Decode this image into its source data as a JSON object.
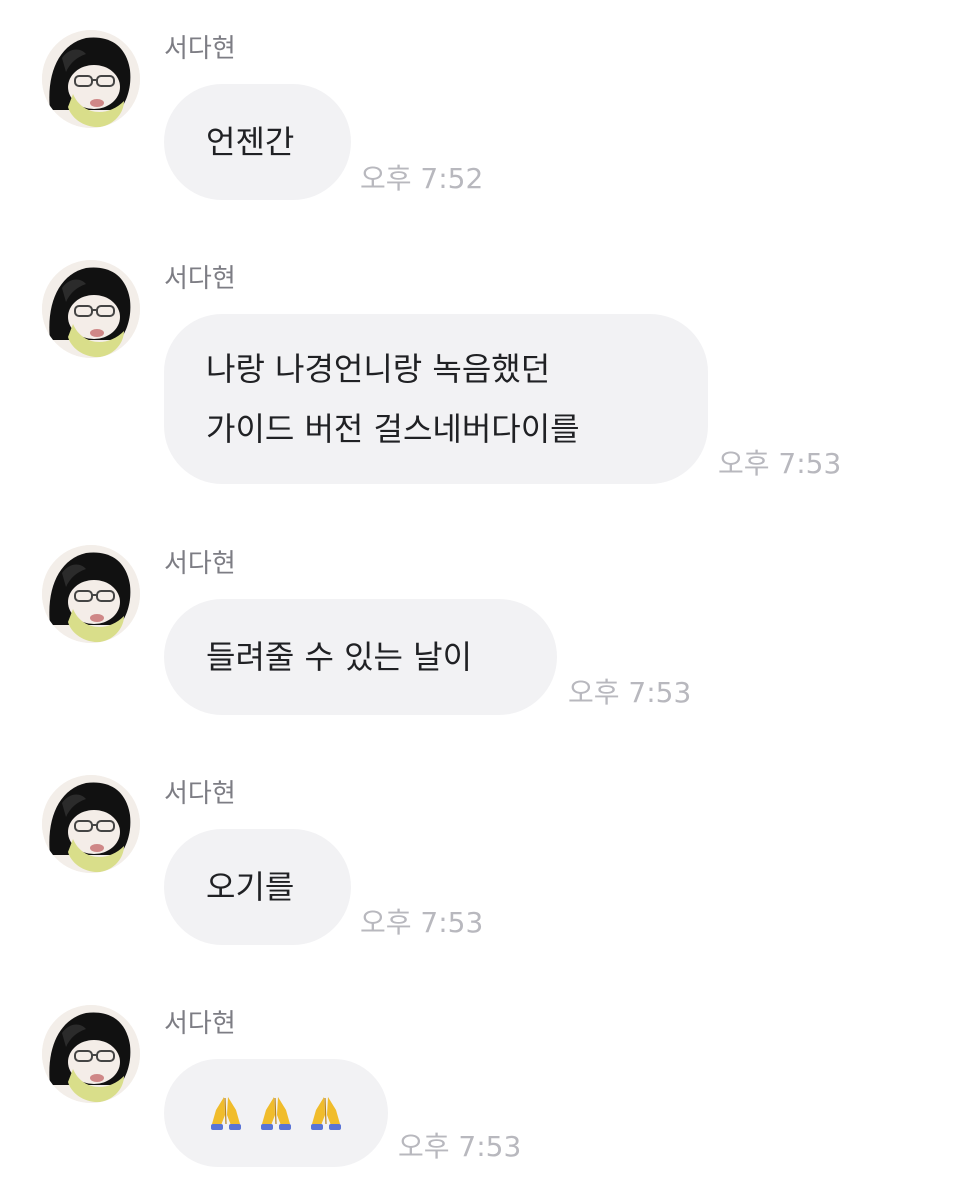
{
  "messages": [
    {
      "sender": "서다현",
      "lines": [
        "언젠간"
      ],
      "time": "오후 7:52"
    },
    {
      "sender": "서다현",
      "lines": [
        "나랑 나경언니랑 녹음했던",
        "가이드 버전 걸스네버다이를"
      ],
      "time": "오후 7:53"
    },
    {
      "sender": "서다현",
      "lines": [
        "들려줄 수 있는 날이"
      ],
      "time": "오후 7:53"
    },
    {
      "sender": "서다현",
      "lines": [
        "오기를"
      ],
      "time": "오후 7:53"
    },
    {
      "sender": "서다현",
      "lines": [],
      "emojis": [
        "folded-hands-icon",
        "folded-hands-icon",
        "folded-hands-icon"
      ],
      "time": "오후 7:53"
    }
  ],
  "colors": {
    "bubble": "#f2f2f4",
    "text": "#202124",
    "sender": "#7d7d84",
    "time": "#b8b8be"
  }
}
